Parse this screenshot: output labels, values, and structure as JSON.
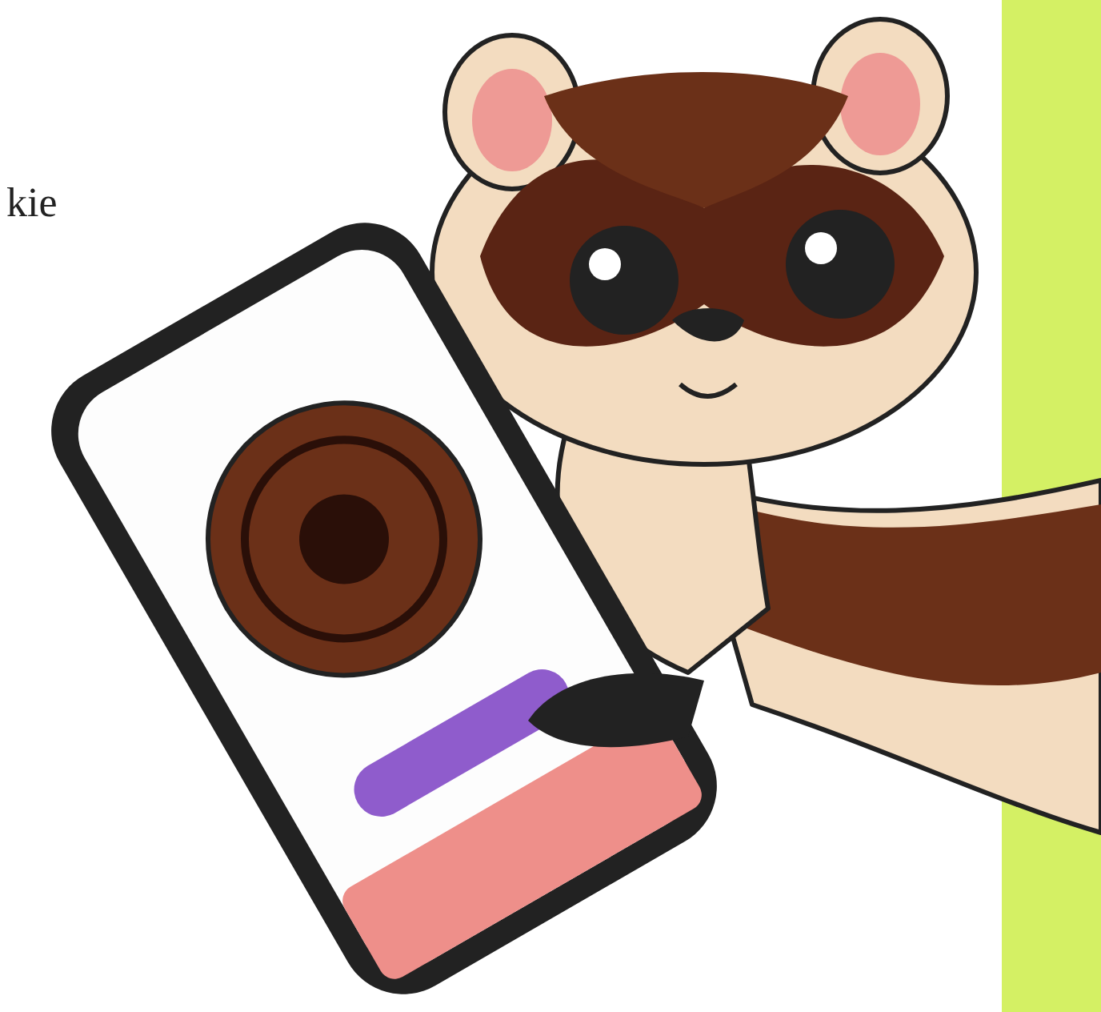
{
  "intro_text": "kie"
}
